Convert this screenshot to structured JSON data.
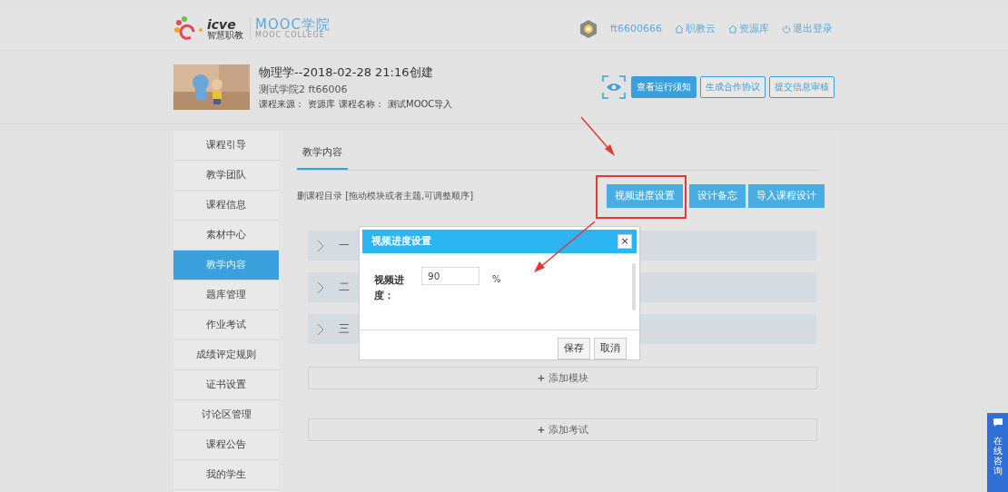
{
  "header": {
    "logo_text": "icve",
    "logo_subtext": "智慧职教",
    "brand": "MOOC学院",
    "brand_sub": "MOOC COLLEGE",
    "user": "ft6600666",
    "links": [
      {
        "kind": "home",
        "label": "职教云"
      },
      {
        "kind": "home",
        "label": "资源库"
      },
      {
        "kind": "power",
        "label": "退出登录"
      }
    ]
  },
  "course": {
    "title": "物理学--2018-02-28 21:16创建",
    "school": "测试学院2  ft66006",
    "source_label": "课程来源：",
    "source": "资源库",
    "name_label": "课程名称：",
    "name": "测试MOOC导入",
    "buttons": [
      {
        "label": "查看运行须知",
        "kind": "primary"
      },
      {
        "label": "生成合作协议",
        "kind": "outline"
      },
      {
        "label": "提交信息审核",
        "kind": "outline"
      }
    ]
  },
  "sidebar": {
    "items": [
      {
        "label": "课程引导",
        "selected": false
      },
      {
        "label": "教学团队",
        "selected": false
      },
      {
        "label": "课程信息",
        "selected": false
      },
      {
        "label": "素材中心",
        "selected": false
      },
      {
        "label": "教学内容",
        "selected": true
      },
      {
        "label": "题库管理",
        "selected": false
      },
      {
        "label": "作业考试",
        "selected": false
      },
      {
        "label": "成绩评定规则",
        "selected": false
      },
      {
        "label": "证书设置",
        "selected": false
      },
      {
        "label": "讨论区管理",
        "selected": false
      },
      {
        "label": "课程公告",
        "selected": false
      },
      {
        "label": "我的学生",
        "selected": false
      }
    ]
  },
  "tabs": [
    {
      "label": "教学内容",
      "selected": true
    }
  ],
  "toolbar": {
    "hint": "删课程目录 [拖动模块或者主题,可调整顺序]",
    "buttons": [
      {
        "label": "视频进度设置",
        "highlighted": true
      },
      {
        "label": "设计备忘",
        "highlighted": false
      },
      {
        "label": "导入课程设计",
        "highlighted": false
      }
    ]
  },
  "modules": [
    {
      "label": "一"
    },
    {
      "label": "二"
    },
    {
      "label": "三"
    }
  ],
  "add_buttons": [
    {
      "icon": "+",
      "label": "添加模块"
    },
    {
      "icon": "+",
      "label": "添加考试"
    }
  ],
  "dialog": {
    "title": "视频进度设置",
    "close": "×",
    "field_label": "视频进度：",
    "value": "90",
    "unit": "%",
    "buttons": [
      "保存",
      "取消"
    ]
  },
  "chat": {
    "label": "在线咨询"
  }
}
